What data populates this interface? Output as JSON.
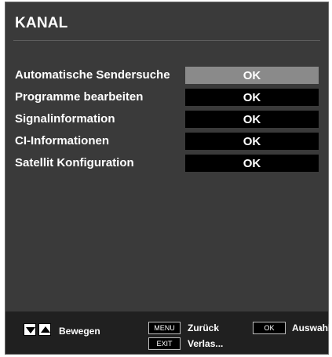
{
  "title": "KANAL",
  "menu": {
    "items": [
      {
        "label": "Automatische Sendersuche",
        "button": "OK"
      },
      {
        "label": "Programme bearbeiten",
        "button": "OK"
      },
      {
        "label": "Signalinformation",
        "button": "OK"
      },
      {
        "label": "CI-Informationen",
        "button": "OK"
      },
      {
        "label": "Satellit Konfiguration",
        "button": "OK"
      }
    ],
    "selected_index": 0
  },
  "footer": {
    "move_icons": [
      "arrow-down-icon",
      "arrow-up-icon"
    ],
    "move_label": "Bewegen",
    "menu_key": "MENU",
    "back_label": "Zurück",
    "exit_key": "EXIT",
    "exit_label": "Verlas...",
    "ok_key": "OK",
    "select_label": "Auswahl"
  },
  "colors": {
    "panel_bg": "#3a3a3a",
    "button_bg": "#000000",
    "selected_button_bg": "#8a8a8a",
    "footer_bg": "#202020",
    "text": "#ffffff"
  }
}
